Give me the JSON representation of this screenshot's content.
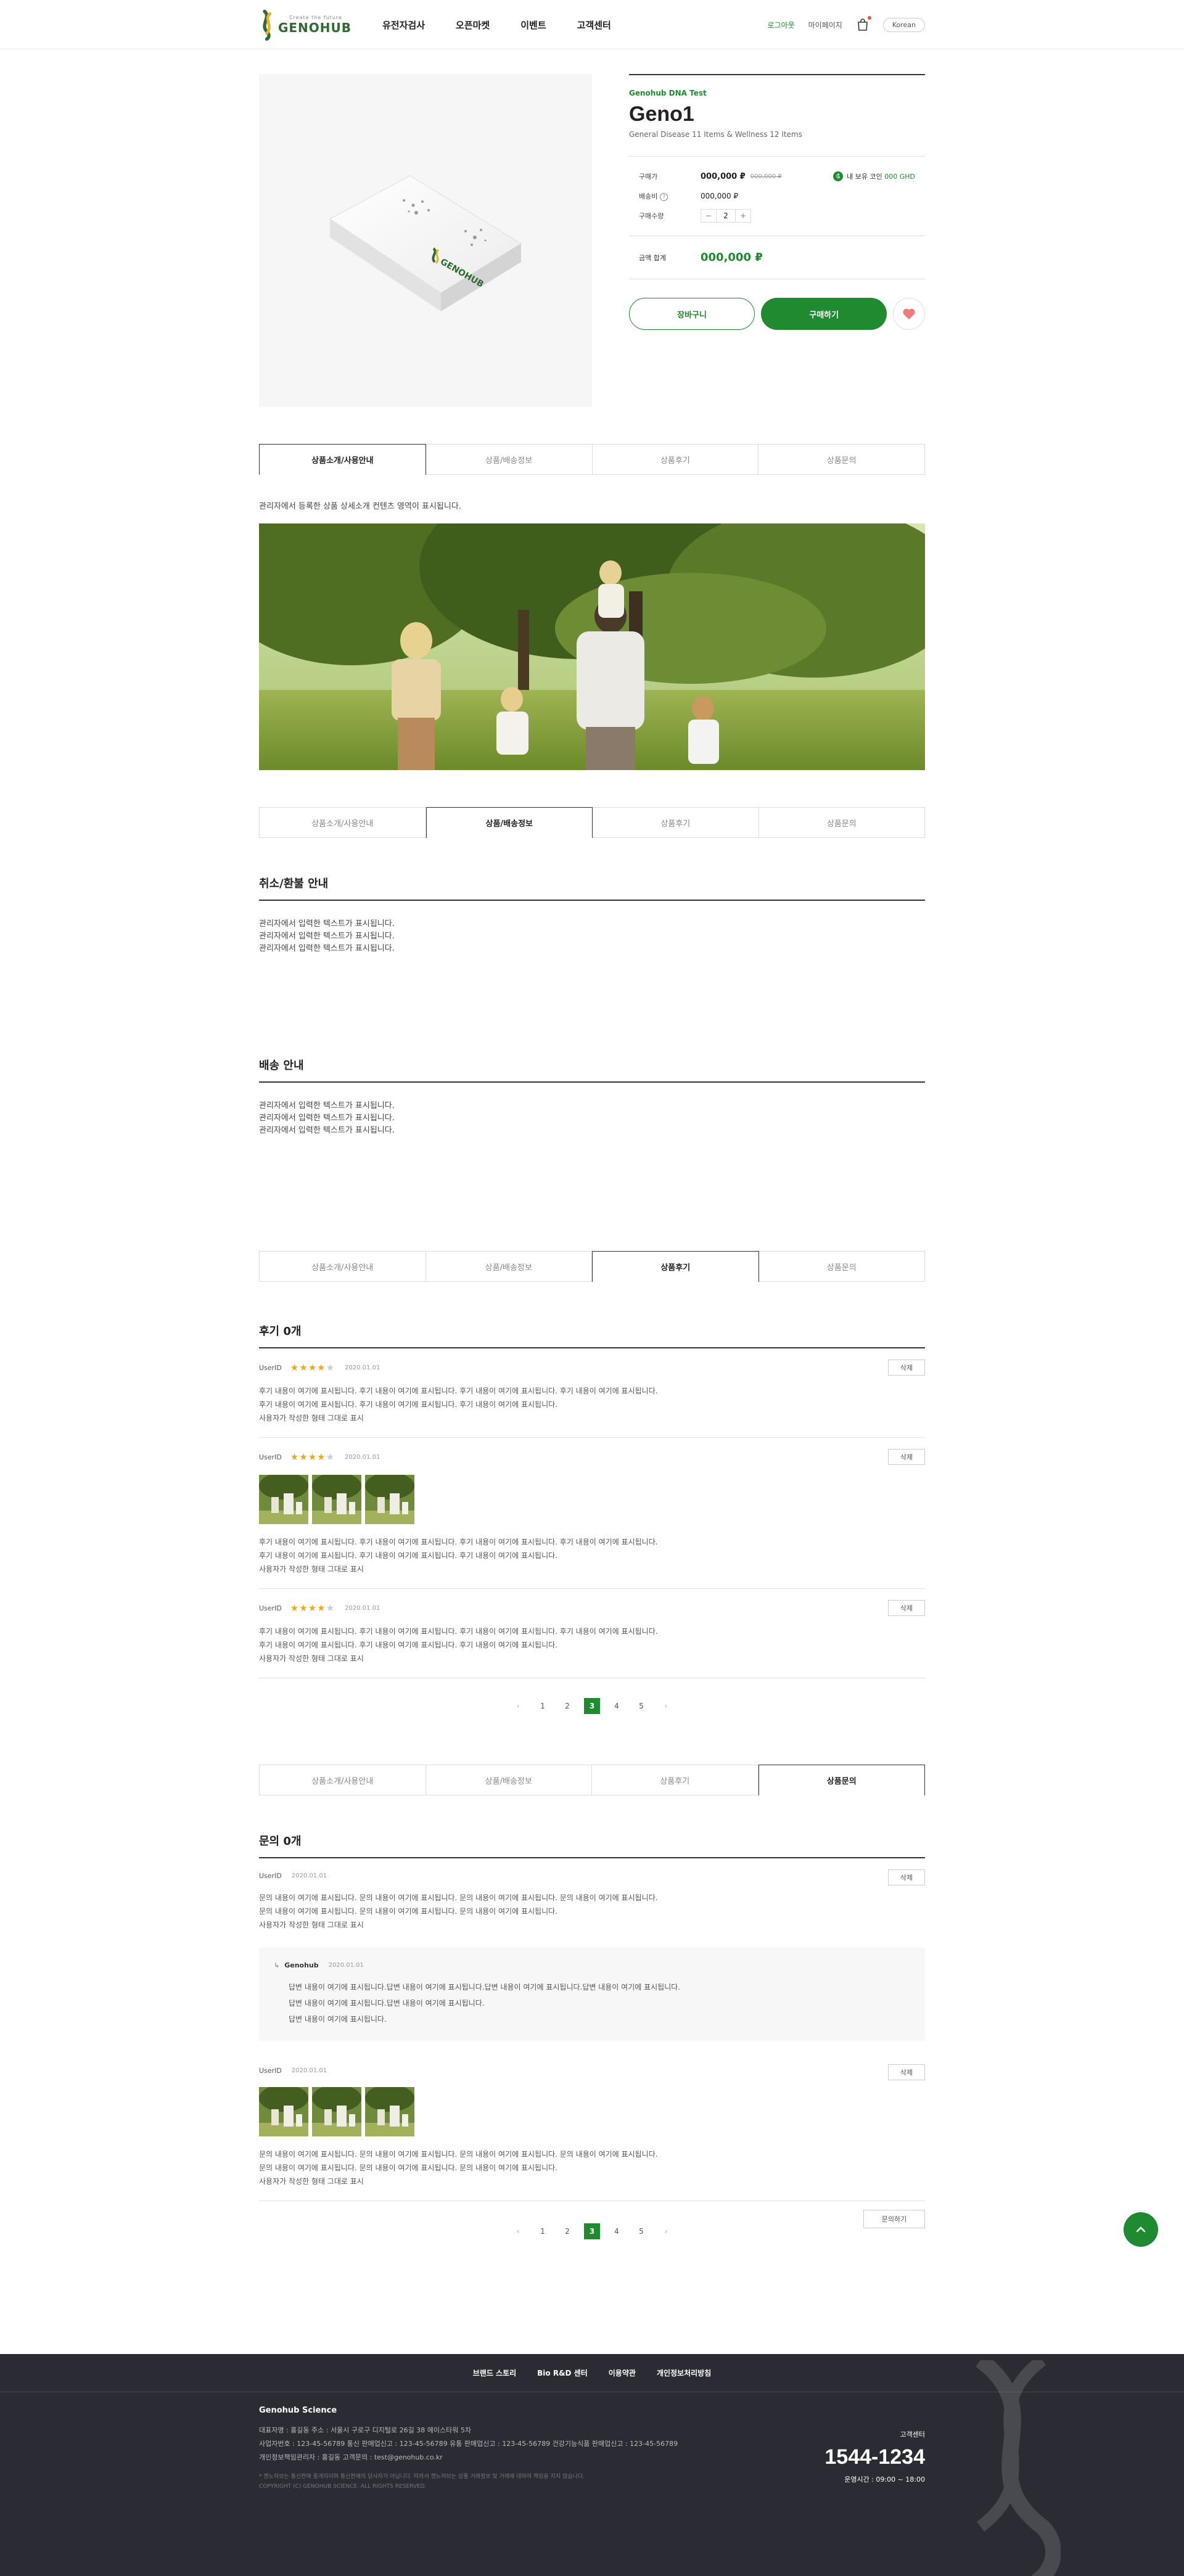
{
  "header": {
    "logo_sub": "Create the future",
    "logo_main": "GENOHUB",
    "nav": [
      "유전자검사",
      "오픈마켓",
      "이벤트",
      "고객센터"
    ],
    "login": "로그아웃",
    "mypage": "마이페이지",
    "lang": "Korean"
  },
  "product": {
    "brand": "Genohub DNA Test",
    "name": "Geno1",
    "desc": "General Disease 11 Items & Wellness 12 Items",
    "price_label": "구매가",
    "price": "000,000 ₽",
    "price_orig": "000,000 ₽",
    "ghd_label": "내 보유 코인",
    "ghd_value": "000 GHD",
    "ship_label": "배송비",
    "ship_value": "000,000 ₽",
    "qty_label": "구매수량",
    "qty_minus": "−",
    "qty_value": "2",
    "qty_plus": "+",
    "total_label": "금액 합계",
    "total_value": "000,000 ₽",
    "cart_btn": "장바구니",
    "buy_btn": "구매하기",
    "box_brand": "GENOHUB"
  },
  "tabs": [
    "상품소개/사용안내",
    "상품/배송정보",
    "상품후기",
    "상품문의"
  ],
  "intro": {
    "note": "관리자에서 등록한 상품 상세소개 컨텐츠 영역이 표시됩니다."
  },
  "cancel": {
    "title": "취소/환불 안내",
    "lines": [
      "관리자에서 입력한 텍스트가 표시됩니다.",
      "관리자에서 입력한 텍스트가 표시됩니다.",
      "관리자에서 입력한 텍스트가 표시됩니다."
    ]
  },
  "delivery": {
    "title": "배송 안내",
    "lines": [
      "관리자에서 입력한 텍스트가 표시됩니다.",
      "관리자에서 입력한 텍스트가 표시됩니다.",
      "관리자에서 입력한 텍스트가 표시됩니다."
    ]
  },
  "reviews": {
    "title": "후기 0개",
    "delete": "삭제",
    "items": [
      {
        "user": "UserID",
        "date": "2020.01.01",
        "rating": 4,
        "lines": [
          "후기 내용이 여기에 표시됩니다. 후기 내용이 여기에 표시됩니다. 후기 내용이 여기에 표시됩니다. 후기 내용이 여기에 표시됩니다.",
          "후기 내용이 여기에 표시됩니다. 후기 내용이 여기에 표시됩니다. 후기 내용이 여기에 표시됩니다.",
          "사용자가 작성한 형태 그대로 표시"
        ]
      },
      {
        "user": "UserID",
        "date": "2020.01.01",
        "rating": 4,
        "lines": [
          "후기 내용이 여기에 표시됩니다. 후기 내용이 여기에 표시됩니다. 후기 내용이 여기에 표시됩니다. 후기 내용이 여기에 표시됩니다.",
          "후기 내용이 여기에 표시됩니다. 후기 내용이 여기에 표시됩니다. 후기 내용이 여기에 표시됩니다.",
          "사용자가 작성한 형태 그대로 표시"
        ]
      },
      {
        "user": "UserID",
        "date": "2020.01.01",
        "rating": 4,
        "lines": [
          "후기 내용이 여기에 표시됩니다. 후기 내용이 여기에 표시됩니다. 후기 내용이 여기에 표시됩니다. 후기 내용이 여기에 표시됩니다.",
          "후기 내용이 여기에 표시됩니다. 후기 내용이 여기에 표시됩니다. 후기 내용이 여기에 표시됩니다.",
          "사용자가 작성한 형태 그대로 표시"
        ]
      }
    ],
    "pages": [
      "1",
      "2",
      "3",
      "4",
      "5"
    ],
    "current_page": "3"
  },
  "qna": {
    "title": "문의 0개",
    "delete": "삭제",
    "items": [
      {
        "user": "UserID",
        "date": "2020.01.01",
        "lines": [
          "문의 내용이 여기에 표시됩니다. 문의 내용이 여기에 표시됩니다. 문의 내용이 여기에 표시됩니다. 문의 내용이 여기에 표시됩니다.",
          "문의 내용이 여기에 표시됩니다. 문의 내용이 여기에 표시됩니다. 문의 내용이 여기에 표시됩니다.",
          "사용자가 작성한 형태 그대로 표시"
        ]
      },
      {
        "user": "UserID",
        "date": "2020.01.01",
        "lines": [
          "문의 내용이 여기에 표시됩니다. 문의 내용이 여기에 표시됩니다. 문의 내용이 여기에 표시됩니다. 문의 내용이 여기에 표시됩니다.",
          "문의 내용이 여기에 표시됩니다. 문의 내용이 여기에 표시됩니다. 문의 내용이 여기에 표시됩니다.",
          "사용자가 작성한 형태 그대로 표시"
        ]
      }
    ],
    "answer": {
      "author": "Genohub",
      "date": "2020.01.01",
      "lines": [
        "답변 내용이 여기에 표시됩니다.답변 내용이 여기에 표시됩니다.답변 내용이 여기에 표시됩니다.답변 내용이 여기에 표시됩니다.",
        "답변 내용이 여기에 표시됩니다.답변 내용이 여기에 표시됩니다.",
        "답변 내용이 여기에 표시됩니다."
      ]
    },
    "ask_btn": "문의하기",
    "pages": [
      "1",
      "2",
      "3",
      "4",
      "5"
    ],
    "current_page": "3"
  },
  "footer": {
    "menu": [
      "브랜드 스토리",
      "Bio R&D 센터",
      "이용약관",
      "개인정보처리방침"
    ],
    "company": "Genohub Science",
    "lines": [
      "대표자명 : 홍길동      주소 : 서울시 구로구 디지털로 26길 38 에이스타워 5차",
      "사업자번호 : 123-45-56789      통신 판매업신고 : 123-45-56789      유통 판매업신고 : 123-45-56789      건강기능식품 판매업신고 : 123-45-56789",
      "개인정보책임관리자 : 홍길동      고객문의 : test@genohub.co.kr"
    ],
    "small": [
      "* 젠노허브는 통신판매 중개자이며 통신판매의 당사자가 아닙니다. 따라서 젠노허브는 상품 거래정보 및 거래에 대하여 책임을 지지 않습니다.",
      "COPYRIGHT (C) GENOHUB SCIENCE. ALL RIGHTS RESERVED."
    ],
    "cs_label": "고객센터",
    "cs_number": "1544-1234",
    "cs_hours": "운영시간 : 09:00 ~ 18:00"
  }
}
